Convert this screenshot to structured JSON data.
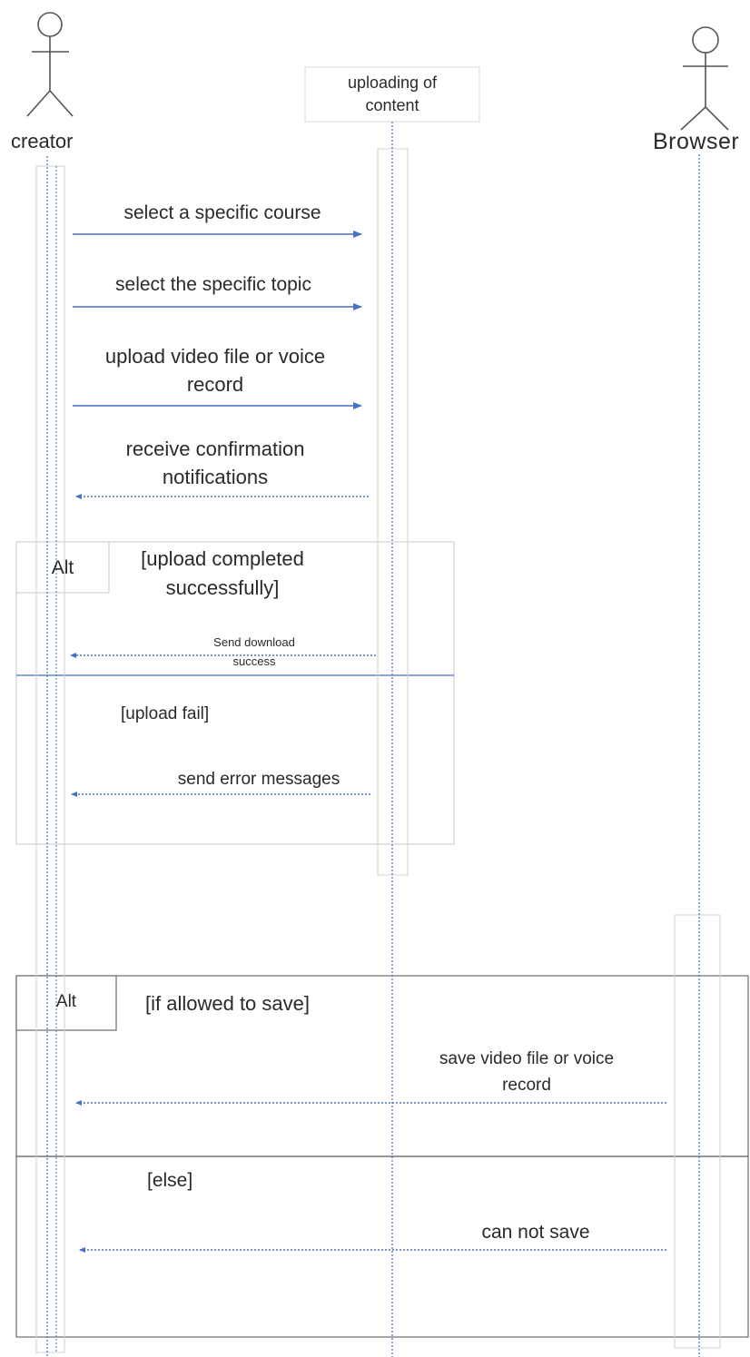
{
  "lifelines": {
    "creator": {
      "label": "creator"
    },
    "uploader": {
      "label": "uploading of\ncontent"
    },
    "browser": {
      "label": "Browser"
    }
  },
  "messages": {
    "m1": "select a specific course",
    "m2": "select the specific topic",
    "m3": "upload video file or voice\nrecord",
    "m4": "receive confirmation\nnotifications",
    "m5": "Send download\nsuccess",
    "m6": "send error messages",
    "m7": "save video file or voice\nrecord",
    "m8": "can not save"
  },
  "fragments": {
    "alt1": {
      "tag": "Alt",
      "guard1": "[upload completed\nsuccessfully]",
      "guard2": "[upload fail]"
    },
    "alt2": {
      "tag": "Alt",
      "guard1": "[if allowed to save]",
      "guard2": "[else]"
    }
  },
  "colors": {
    "arrow": "#4472c4",
    "lifeline": "#4472c4",
    "frame": "#bfbfbf",
    "frame_dark": "#595959",
    "text": "#2a2a2a"
  }
}
